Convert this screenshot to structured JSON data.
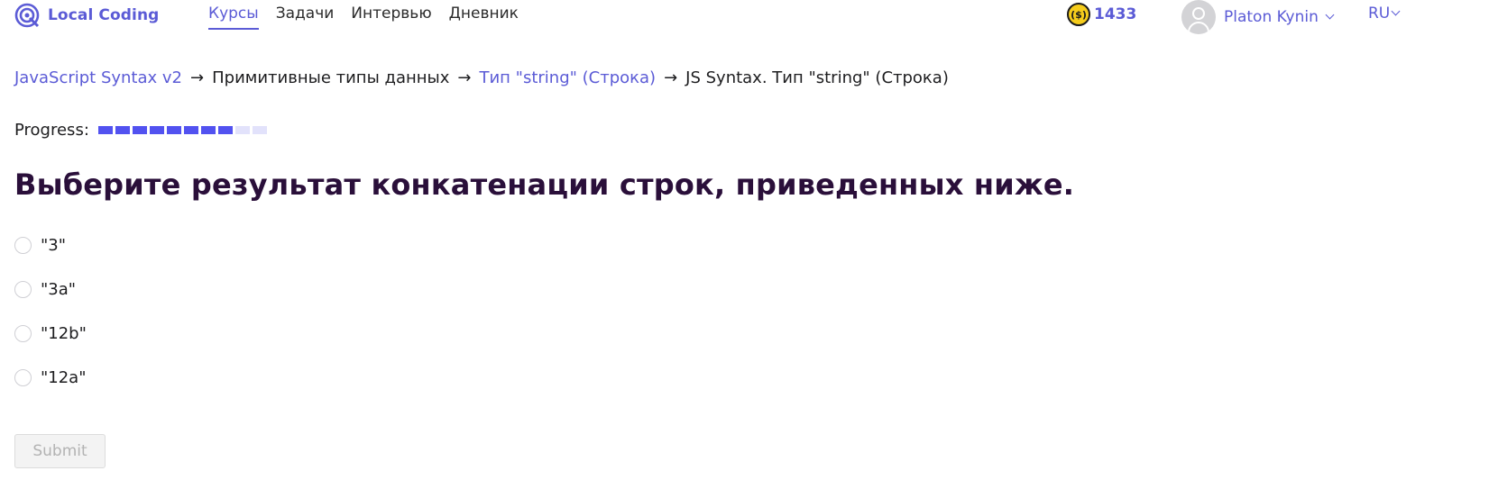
{
  "header": {
    "logo_text": "Local Coding",
    "logo_icon": "local-coding-logo-icon",
    "nav": [
      {
        "label": "Курсы",
        "active": true
      },
      {
        "label": "Задачи",
        "active": false
      },
      {
        "label": "Интервью",
        "active": false
      },
      {
        "label": "Дневник",
        "active": false
      }
    ],
    "coins": {
      "icon": "coin-icon",
      "icon_text": "($)",
      "count": "1433"
    },
    "user": {
      "name": "Platon Kynin",
      "avatar_icon": "user-avatar-icon"
    },
    "language": "RU"
  },
  "breadcrumb": {
    "items": [
      {
        "label": "JavaScript Syntax v2",
        "link": true
      },
      {
        "label": "Примитивные типы данных",
        "link": false
      },
      {
        "label": "Тип \"string\" (Строка)",
        "link": true
      },
      {
        "label": "JS Syntax. Тип \"string\" (Строка)",
        "link": false
      }
    ],
    "separator": "→"
  },
  "progress": {
    "label": "Progress:",
    "completed": 8,
    "total": 10
  },
  "question": {
    "text": "Выберите результат конкатенации строк, приведенных ниже."
  },
  "options": [
    {
      "label": "\"3\"",
      "checked": false
    },
    {
      "label": "\"3a\"",
      "checked": false
    },
    {
      "label": "\"12b\"",
      "checked": false
    },
    {
      "label": "\"12a\"",
      "checked": false
    }
  ],
  "submit": {
    "label": "Submit",
    "disabled": true
  },
  "colors": {
    "accent": "#5b5bd6",
    "progress_filled": "#5252f0",
    "progress_empty": "#e2e2fb",
    "question_text": "#2a0f3a",
    "coin": "#f5cc1c"
  }
}
